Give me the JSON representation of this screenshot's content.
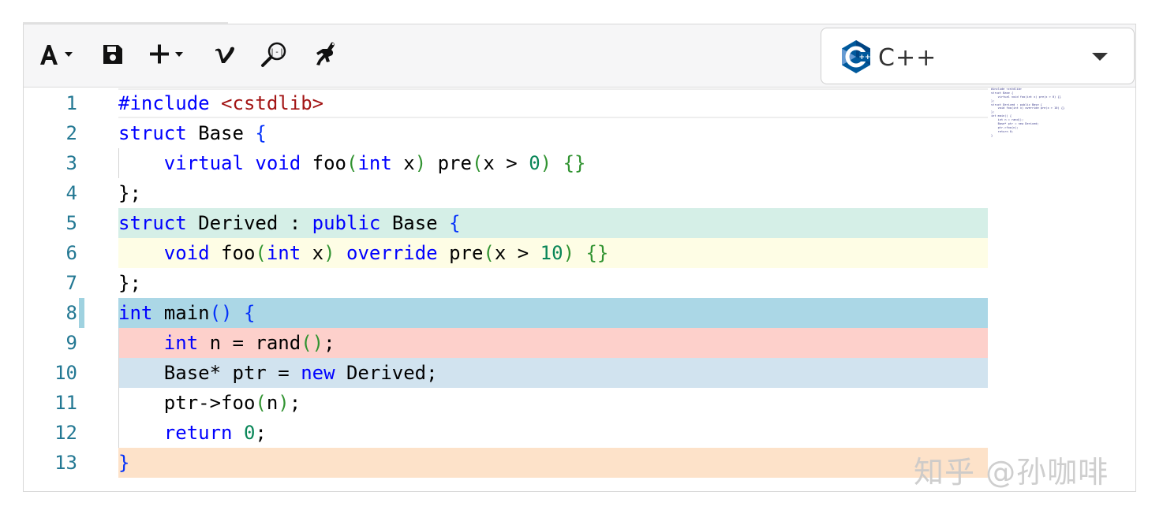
{
  "toolbar": {
    "font_button_icon": "font-size-icon",
    "save_button_icon": "save-icon",
    "add_button_icon": "plus-icon",
    "vim_button_icon": "vim-icon",
    "find_button_icon": "search-regex-icon",
    "run_button_icon": "runner-icon",
    "language": {
      "label": "C++",
      "icon": "cpp-logo-icon",
      "caret_icon": "chevron-down-icon"
    }
  },
  "editor": {
    "line_numbers": [
      "1",
      "2",
      "3",
      "4",
      "5",
      "6",
      "7",
      "8",
      "9",
      "10",
      "11",
      "12",
      "13"
    ],
    "highlight_colors": {
      "line5": "#d5efe7",
      "line6": "#fefde5",
      "line8": "#abd7e6",
      "line9": "#fdd0cb",
      "line10": "#d1e3ef",
      "line13": "#fde2c9"
    },
    "lines": [
      [
        {
          "t": "#include ",
          "c": "pp"
        },
        {
          "t": "<cstdlib>",
          "c": "str"
        }
      ],
      [
        {
          "t": "struct ",
          "c": "kw"
        },
        {
          "t": "Base ",
          "c": ""
        },
        {
          "t": "{",
          "c": "br2"
        }
      ],
      [
        {
          "t": "    ",
          "c": ""
        },
        {
          "t": "virtual ",
          "c": "kw"
        },
        {
          "t": "void ",
          "c": "kw"
        },
        {
          "t": "foo",
          "c": ""
        },
        {
          "t": "(",
          "c": "br"
        },
        {
          "t": "int ",
          "c": "kw"
        },
        {
          "t": "x",
          "c": ""
        },
        {
          "t": ")",
          "c": "br"
        },
        {
          "t": " pre",
          "c": ""
        },
        {
          "t": "(",
          "c": "br"
        },
        {
          "t": "x > ",
          "c": ""
        },
        {
          "t": "0",
          "c": "num"
        },
        {
          "t": ")",
          "c": "br"
        },
        {
          "t": " ",
          "c": ""
        },
        {
          "t": "{}",
          "c": "br"
        }
      ],
      [
        {
          "t": "};",
          "c": ""
        }
      ],
      [
        {
          "t": "struct ",
          "c": "kw"
        },
        {
          "t": "Derived : ",
          "c": ""
        },
        {
          "t": "public ",
          "c": "kw"
        },
        {
          "t": "Base ",
          "c": ""
        },
        {
          "t": "{",
          "c": "br2"
        }
      ],
      [
        {
          "t": "    ",
          "c": ""
        },
        {
          "t": "void ",
          "c": "kw"
        },
        {
          "t": "foo",
          "c": ""
        },
        {
          "t": "(",
          "c": "br"
        },
        {
          "t": "int ",
          "c": "kw"
        },
        {
          "t": "x",
          "c": ""
        },
        {
          "t": ")",
          "c": "br"
        },
        {
          "t": " ",
          "c": ""
        },
        {
          "t": "override ",
          "c": "kw"
        },
        {
          "t": "pre",
          "c": ""
        },
        {
          "t": "(",
          "c": "br"
        },
        {
          "t": "x > ",
          "c": ""
        },
        {
          "t": "10",
          "c": "num"
        },
        {
          "t": ")",
          "c": "br"
        },
        {
          "t": " ",
          "c": ""
        },
        {
          "t": "{}",
          "c": "br"
        }
      ],
      [
        {
          "t": "};",
          "c": ""
        }
      ],
      [
        {
          "t": "int ",
          "c": "kw"
        },
        {
          "t": "main",
          "c": ""
        },
        {
          "t": "()",
          "c": "br2"
        },
        {
          "t": " ",
          "c": ""
        },
        {
          "t": "{",
          "c": "br2"
        }
      ],
      [
        {
          "t": "    ",
          "c": ""
        },
        {
          "t": "int ",
          "c": "kw"
        },
        {
          "t": "n = rand",
          "c": ""
        },
        {
          "t": "()",
          "c": "br"
        },
        {
          "t": ";",
          "c": ""
        }
      ],
      [
        {
          "t": "    Base* ptr = ",
          "c": ""
        },
        {
          "t": "new ",
          "c": "kw"
        },
        {
          "t": "Derived;",
          "c": ""
        }
      ],
      [
        {
          "t": "    ptr->foo",
          "c": ""
        },
        {
          "t": "(",
          "c": "br"
        },
        {
          "t": "n",
          "c": ""
        },
        {
          "t": ")",
          "c": "br"
        },
        {
          "t": ";",
          "c": ""
        }
      ],
      [
        {
          "t": "    ",
          "c": ""
        },
        {
          "t": "return ",
          "c": "kw"
        },
        {
          "t": "0",
          "c": "num"
        },
        {
          "t": ";",
          "c": ""
        }
      ],
      [
        {
          "t": "}",
          "c": "br2"
        }
      ]
    ]
  },
  "watermark": "知乎 @孙咖啡"
}
